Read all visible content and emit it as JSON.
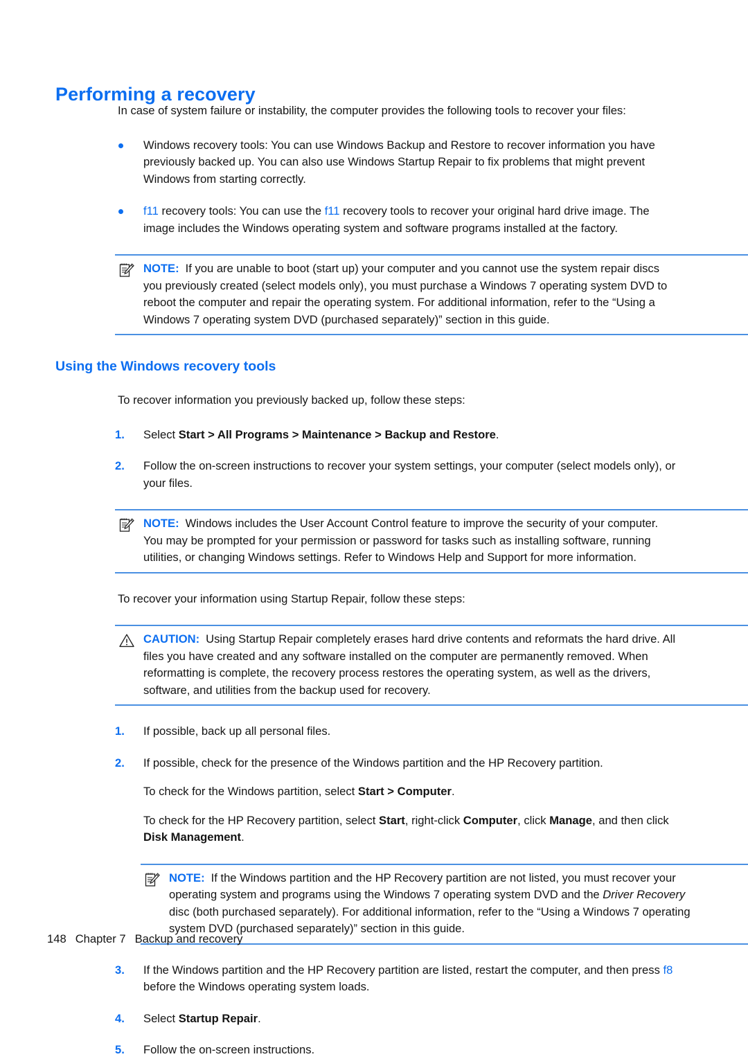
{
  "document": {
    "heading": "Performing a recovery",
    "intro": "In case of system failure or instability, the computer provides the following tools to recover your files:",
    "bullets": [
      {
        "id": "windows-recovery-tools",
        "text": "Windows recovery tools: You can use Windows Backup and Restore to recover information you have previously backed up. You can also use Windows Startup Repair to fix problems that might prevent Windows from starting correctly."
      },
      {
        "id": "f11-recovery-tools",
        "lead_key": "f11",
        "text_part1": " recovery tools: You can use the ",
        "inline_key": "f11",
        "text_part2": " recovery tools to recover your original hard drive image. The image includes the Windows operating system and software programs installed at the factory."
      }
    ],
    "note1": {
      "label": "NOTE:",
      "icon": "note-pad-pencil-icon",
      "text": "If you are unable to boot (start up) your computer and you cannot use the system repair discs you previously created (select models only), you must purchase a Windows 7 operating system DVD to reboot the computer and repair the operating system. For additional information, refer to the “Using a Windows 7 operating system DVD (purchased separately)” section in this guide."
    },
    "section": {
      "heading": "Using the Windows recovery tools",
      "intro": "To recover information you previously backed up, follow these steps:",
      "steps": [
        {
          "num": "1.",
          "prefix": "Select ",
          "bold": "Start > All Programs > Maintenance > Backup and Restore",
          "suffix": "."
        },
        {
          "num": "2.",
          "text": "Follow the on-screen instructions to recover your system settings, your computer (select models only), or your files."
        }
      ]
    },
    "note2": {
      "label": "NOTE:",
      "icon": "note-pad-pencil-icon",
      "text": "Windows includes the User Account Control feature to improve the security of your computer. You may be prompted for your permission or password for tasks such as installing software, running utilities, or changing Windows settings. Refer to Windows Help and Support for more information."
    },
    "startup_intro": "To recover your information using Startup Repair, follow these steps:",
    "caution": {
      "label": "CAUTION:",
      "icon": "warning-triangle-icon",
      "text": "Using Startup Repair completely erases hard drive contents and reformats the hard drive. All files you have created and any software installed on the computer are permanently removed. When reformatting is complete, the recovery process restores the operating system, as well as the drivers, software, and utilities from the backup used for recovery."
    },
    "startup_steps_a": [
      {
        "num": "1.",
        "text": "If possible, back up all personal files."
      },
      {
        "num": "2.",
        "text": "If possible, check for the presence of the Windows partition and the HP Recovery partition."
      }
    ],
    "check_windows_partition": {
      "prefix": "To check for the Windows partition, select ",
      "bold": "Start > Computer",
      "suffix": "."
    },
    "check_hp_partition": {
      "prefix": "To check for the HP Recovery partition, select ",
      "bold1": "Start",
      "mid1": ", right-click ",
      "bold2": "Computer",
      "mid2": ", click ",
      "bold3": "Manage",
      "mid3": ", and then click ",
      "bold4": "Disk Management",
      "suffix": "."
    },
    "note3": {
      "label": "NOTE:",
      "icon": "note-pad-pencil-icon",
      "part1": "If the Windows partition and the HP Recovery partition are not listed, you must recover your operating system and programs using the Windows 7 operating system DVD and the ",
      "italic": "Driver Recovery",
      "part2": " disc (both purchased separately). For additional information, refer to the “Using a Windows 7 operating system DVD (purchased separately)” section in this guide."
    },
    "startup_steps_b": [
      {
        "num": "3.",
        "part1": "If the Windows partition and the HP Recovery partition are listed, restart the computer, and then press ",
        "key": "f8",
        "part2": " before the Windows operating system loads."
      },
      {
        "num": "4.",
        "prefix": "Select ",
        "bold": "Startup Repair",
        "suffix": "."
      },
      {
        "num": "5.",
        "text": "Follow the on-screen instructions."
      }
    ],
    "footer": {
      "page_number": "148",
      "chapter": "Chapter 7",
      "title": "Backup and recovery"
    },
    "colors": {
      "heading_blue": "#0c6ef0",
      "rule_blue": "#4a90e2",
      "body_text": "#141414"
    }
  }
}
